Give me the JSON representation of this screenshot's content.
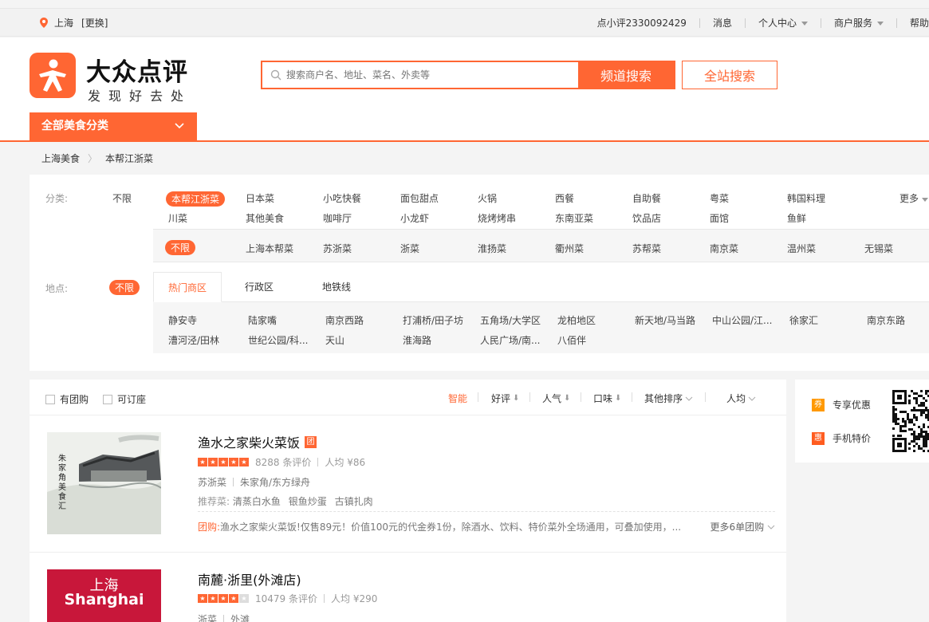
{
  "topbar": {
    "city": "上海",
    "change": "[更换]",
    "items": [
      {
        "label": "点小评2330092429",
        "caret": false
      },
      {
        "label": "消息",
        "caret": false
      },
      {
        "label": "个人中心",
        "caret": true
      },
      {
        "label": "商户服务",
        "caret": true
      },
      {
        "label": "帮助",
        "caret": false
      }
    ]
  },
  "header": {
    "logo_title": "大众点评",
    "logo_sub": "发现好去处",
    "search_placeholder": "搜索商户名、地址、菜名、外卖等",
    "channel_search": "频道搜索",
    "all_search": "全站搜索",
    "category_menu": "全部美食分类"
  },
  "breadcrumb": [
    "上海美食",
    "本帮江浙菜"
  ],
  "filters": {
    "category_label": "分类:",
    "category_all": "不限",
    "categories_row1": [
      "本帮江浙菜",
      "日本菜",
      "小吃快餐",
      "面包甜点",
      "火锅",
      "西餐",
      "自助餐",
      "粤菜",
      "韩国料理"
    ],
    "categories_row2": [
      "川菜",
      "其他美食",
      "咖啡厅",
      "小龙虾",
      "烧烤烤串",
      "东南亚菜",
      "饮品店",
      "面馆",
      "鱼鲜"
    ],
    "more": "更多",
    "subcats": [
      "不限",
      "上海本帮菜",
      "苏浙菜",
      "浙菜",
      "淮扬菜",
      "衢州菜",
      "苏帮菜",
      "南京菜",
      "温州菜",
      "无锡菜"
    ],
    "location_label": "地点:",
    "location_all": "不限",
    "location_tabs": [
      "热门商区",
      "行政区",
      "地铁线"
    ],
    "areas_row1": [
      "静安寺",
      "陆家嘴",
      "南京西路",
      "打浦桥/田子坊",
      "五角场/大学区",
      "龙柏地区",
      "新天地/马当路",
      "中山公园/江...",
      "徐家汇",
      "南京东路"
    ],
    "areas_row2": [
      "漕河泾/田林",
      "世纪公园/科...",
      "天山",
      "淮海路",
      "人民广场/南...",
      "八佰伴"
    ]
  },
  "sortbar": {
    "checks": [
      "有团购",
      "可订座"
    ],
    "sorts": [
      "智能",
      "好评",
      "人气",
      "口味",
      "其他排序",
      "人均"
    ]
  },
  "shops": [
    {
      "name": "渔水之家柴火菜饭",
      "badge": "团",
      "stars": 5,
      "reviews": "8288",
      "reviews_unit": "条评价",
      "avg": "人均 ¥86",
      "cuisine": "苏浙菜",
      "area": "朱家角/东方绿舟",
      "rec_label": "推荐菜:",
      "dishes": [
        "清蒸白水鱼",
        "银鱼炒蛋",
        "古镇扎肉"
      ],
      "deal_label": "团购:",
      "deal_text": "渔水之家柴火菜饭!仅售89元！价值100元的代金券1份，除酒水、饮料、特价菜外全场通用，可叠加使用，...",
      "deal_more": "更多6单团购",
      "thumb_text": "朱家角美食汇"
    },
    {
      "name": "南麓·浙里(外滩店)",
      "badge": "",
      "stars": 4,
      "reviews": "10479",
      "reviews_unit": "条评价",
      "avg": "人均 ¥290",
      "cuisine": "浙菜",
      "area": "外滩",
      "thumb_text_cn": "上海",
      "thumb_text_en": "Shanghai"
    }
  ],
  "promo": {
    "items": [
      {
        "icon": "券",
        "label": "专享优惠"
      },
      {
        "icon": "惠",
        "label": "手机特价"
      }
    ]
  },
  "colors": {
    "brand": "#ff6633"
  }
}
